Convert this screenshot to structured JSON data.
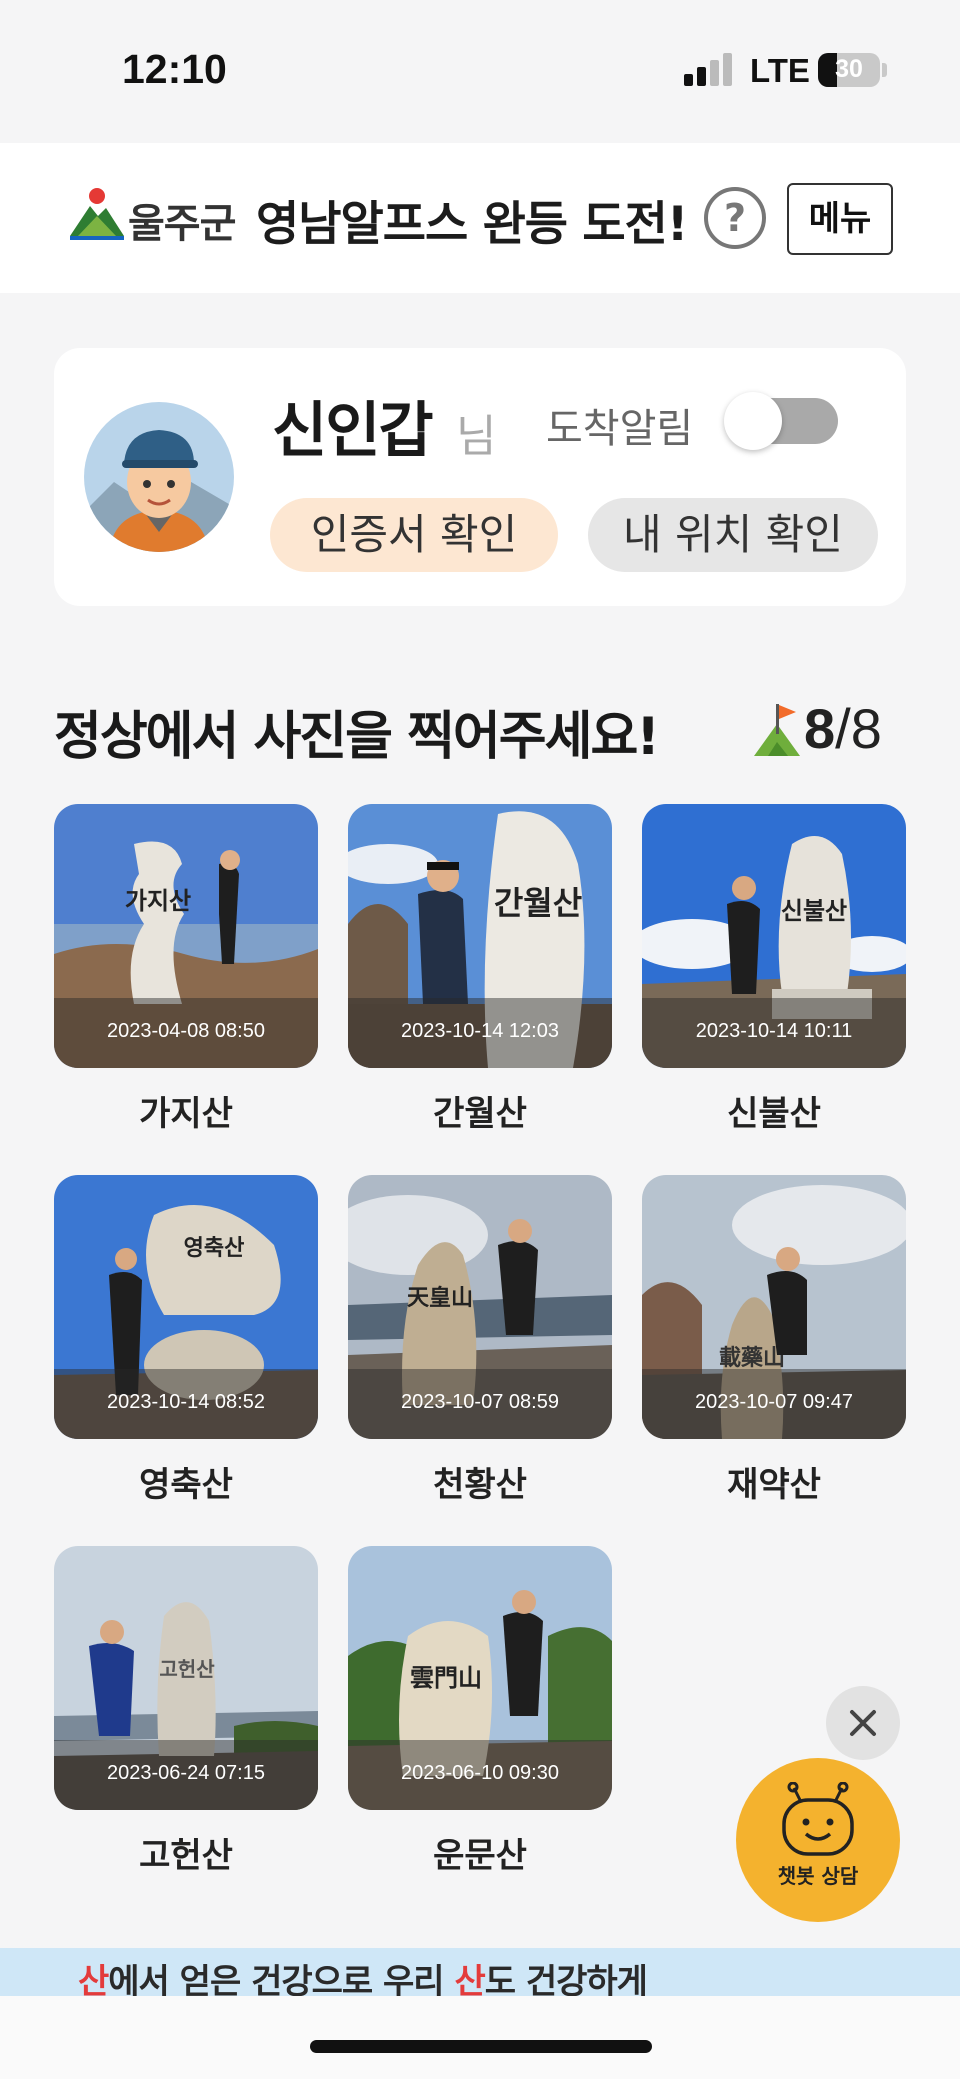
{
  "status_bar": {
    "time": "12:10",
    "network": "LTE",
    "battery": "30",
    "battery_level": 30
  },
  "header": {
    "logo_text": "울주군",
    "title": "영남알프스 완등 도전!",
    "help_icon": "question-circle-icon",
    "menu_label": "메뉴"
  },
  "profile": {
    "name": "신인갑",
    "suffix": "님",
    "alarm_label": "도착알림",
    "alarm_on": false,
    "cert_button": "인증서 확인",
    "location_button": "내 위치 확인"
  },
  "summit": {
    "title": "정상에서 사진을 찍어주세요!",
    "done": "8",
    "separator": "/",
    "total": "8"
  },
  "mountains": [
    {
      "name": "가지산",
      "date": "2023-04-08 08:50",
      "stone": "가지산"
    },
    {
      "name": "간월산",
      "date": "2023-10-14 12:03",
      "stone": "간월산"
    },
    {
      "name": "신불산",
      "date": "2023-10-14 10:11",
      "stone": "신불산"
    },
    {
      "name": "영축산",
      "date": "2023-10-14 08:52",
      "stone": "영축산"
    },
    {
      "name": "천황산",
      "date": "2023-10-07 08:59",
      "stone": "天皇山"
    },
    {
      "name": "재약산",
      "date": "2023-10-07 09:47",
      "stone": "載藥山"
    },
    {
      "name": "고헌산",
      "date": "2023-06-24 07:15",
      "stone": "고헌산"
    },
    {
      "name": "운문산",
      "date": "2023-06-10 09:30",
      "stone": "雲門山"
    }
  ],
  "chatbot": {
    "label": "챗봇 상담",
    "close_icon": "close-icon"
  },
  "banner": {
    "hl1": "산",
    "part1": "에서 얻은 건강으로 우리 ",
    "hl2": "산",
    "part2": "도 건강하게"
  },
  "colors": {
    "accent_orange": "#f4b22e",
    "cert_bg": "#fde7d2",
    "banner_bg": "#cfe7f7",
    "banner_highlight": "#e33b3b"
  }
}
